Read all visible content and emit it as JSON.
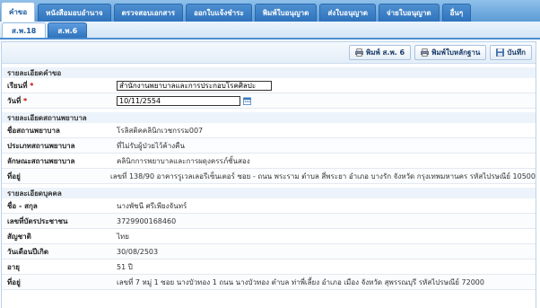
{
  "top_tabs": [
    "คำขอ",
    "หนังสือมอบอำนาจ",
    "ตรวจสอบเอกสาร",
    "ออกใบแจ้งชำระ",
    "พิมพ์ใบอนุญาต",
    "ส่งใบอนุญาต",
    "จ่ายใบอนุญาต",
    "อื่นๆ"
  ],
  "sub_tabs": [
    "ส.พ.18",
    "ส.พ.6"
  ],
  "toolbar": {
    "print_sp6": "พิมพ์ ส.พ. 6",
    "print_evidence": "พิมพ์ใบหลักฐาน",
    "save": "บันทึก"
  },
  "request": {
    "heading": "รายละเอียดคำขอ",
    "requester_label": "เรียนที่",
    "requester_value": "สำนักงานพยาบาลและการประกอบโรคศิลปะ",
    "date_label": "วันที่",
    "date_value": "10/11/2554",
    "required_mark": "*"
  },
  "facility": {
    "heading": "รายละเอียดสถานพยาบาล",
    "rows": [
      {
        "label": "ชื่อสถานพยาบาล",
        "value": "โรลิสติคคลินิกเวชกรรม007"
      },
      {
        "label": "ประเภทสถานพยาบาล",
        "value": "ที่ไม่รับผู้ป่วยไว้ค้างคืน"
      },
      {
        "label": "ลักษณะสถานพยาบาล",
        "value": "คลินิกการพยาบาลและการผดุงครรภ์ชั้นสอง"
      },
      {
        "label": "ที่อยู่",
        "value": "เลขที่ 138/90 อาคารรูเวลเลอรีเซ็นเตอร์ ซอย - ถนน พระราม ตำบล สี่พระยา อำเภอ บางรัก จังหวัด กรุงเทพมหานคร รหัสไปรษณีย์ 10500"
      }
    ]
  },
  "person": {
    "heading": "รายละเอียดบุคคล",
    "rows": [
      {
        "label": "ชื่อ - สกุล",
        "value": "นางพัชนี ศรีเพียงจันทร์"
      },
      {
        "label": "เลขที่บัตรประชาชน",
        "value": "3729900168460"
      },
      {
        "label": "สัญชาติ",
        "value": "ไทย"
      },
      {
        "label": "วันเดือนปีเกิด",
        "value": "30/08/2503"
      },
      {
        "label": "อายุ",
        "value": "51 ปี"
      },
      {
        "label": "ที่อยู่",
        "value": "เลขที่ 7 หมู่ 1 ซอย นางบัวทอง 1 ถนน นางบัวทอง ตำบล ท่าพี่เลี้ยง อำเภอ เมือง จังหวัด สุพรรณบุรี รหัสไปรษณีย์ 72000"
      }
    ]
  }
}
